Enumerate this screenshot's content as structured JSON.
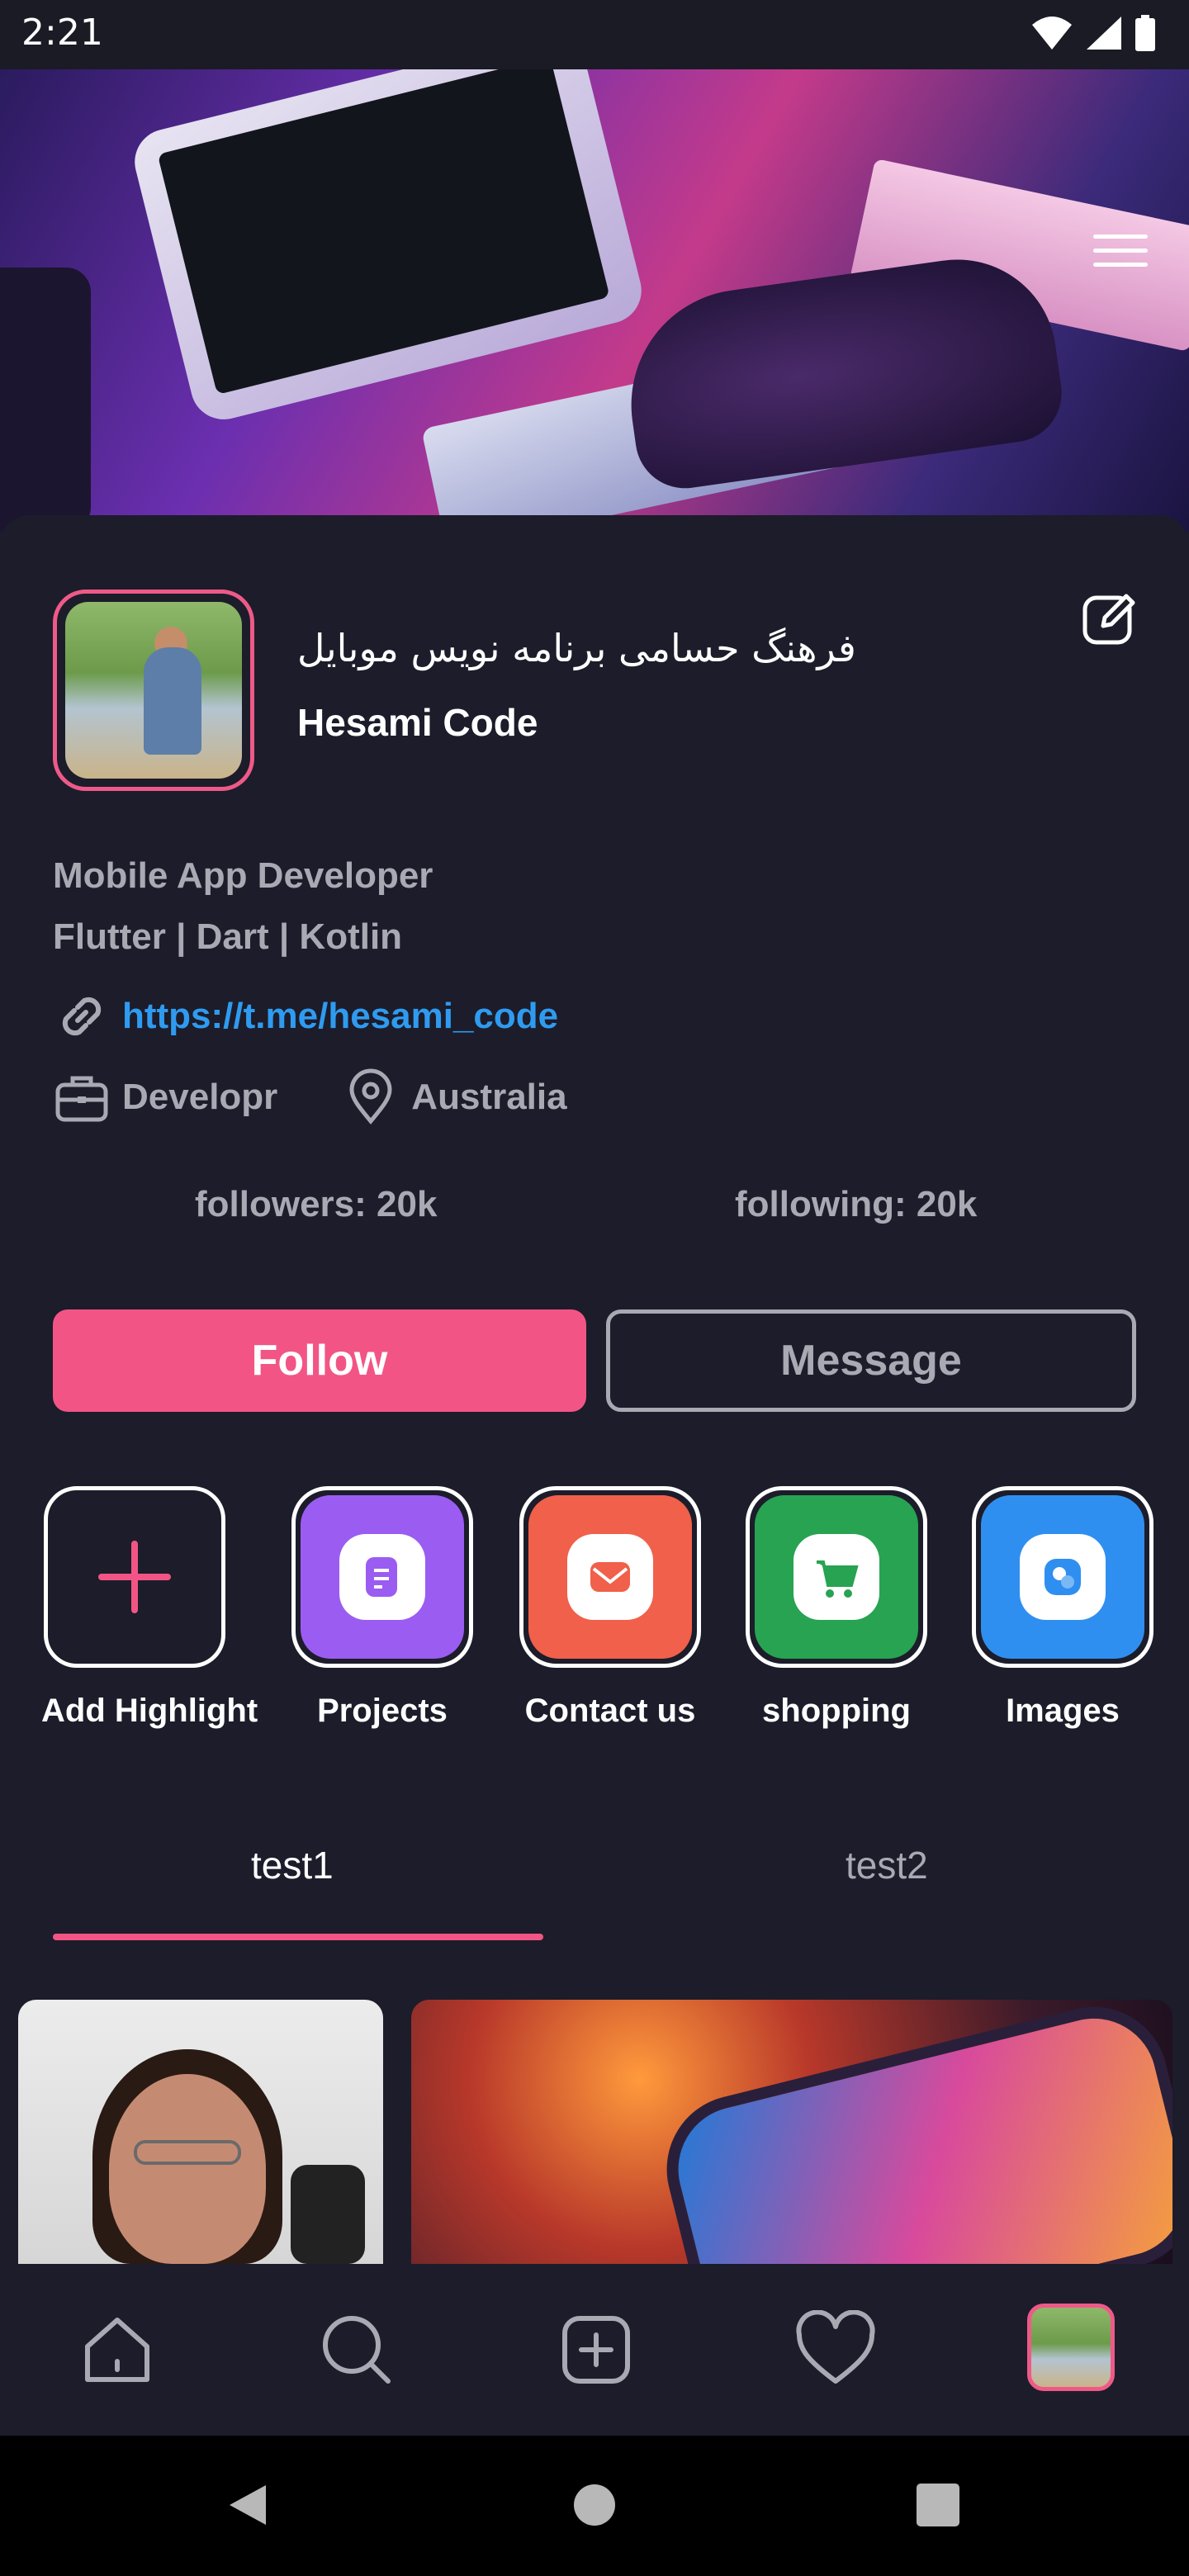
{
  "status_bar": {
    "time": "2:21"
  },
  "profile": {
    "name_fa": "فرهنگ حسامی برنامه نویس موبایل",
    "name_en": "Hesami Code",
    "bio_line1": "Mobile App Developer",
    "bio_line2": "Flutter | Dart | Kotlin",
    "link": "https://t.me/hesami_code",
    "job": "Developr",
    "location": "Australia",
    "followers": "followers: 20k",
    "following": "following: 20k"
  },
  "actions": {
    "follow_label": "Follow",
    "message_label": "Message"
  },
  "highlights": [
    {
      "label": "Add Highlight",
      "color": "#1c1c2a"
    },
    {
      "label": "Projects",
      "color": "#9b5cf2"
    },
    {
      "label": "Contact us",
      "color": "#f0604a"
    },
    {
      "label": "shopping",
      "color": "#27a352"
    },
    {
      "label": "Images",
      "color": "#2f8ff0"
    }
  ],
  "tabs": [
    {
      "label": "test1"
    },
    {
      "label": "test2"
    }
  ],
  "colors": {
    "accent": "#f25585",
    "link": "#2f9bf0",
    "background": "#1c1c2a",
    "muted": "#a9a9b4"
  },
  "bottom_nav": [
    "home-icon",
    "search-icon",
    "add-icon",
    "heart-icon",
    "profile-avatar"
  ]
}
